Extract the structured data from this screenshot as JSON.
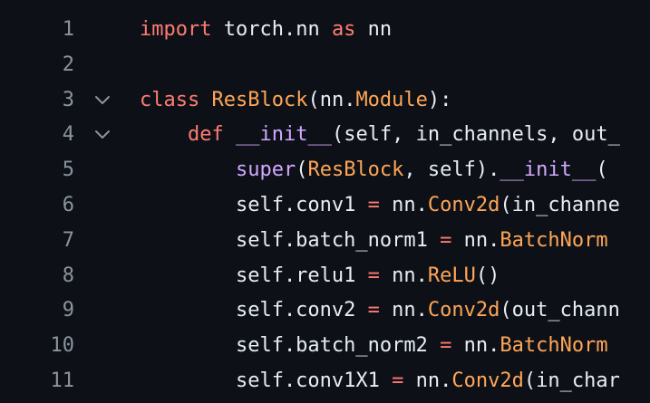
{
  "editor": {
    "lines": [
      {
        "number": "1",
        "foldable": false,
        "tokens": [
          {
            "t": "import",
            "c": "kw"
          },
          {
            "t": " torch.nn ",
            "c": "plain"
          },
          {
            "t": "as",
            "c": "kw"
          },
          {
            "t": " nn",
            "c": "plain"
          }
        ]
      },
      {
        "number": "2",
        "foldable": false,
        "tokens": []
      },
      {
        "number": "3",
        "foldable": true,
        "tokens": [
          {
            "t": "class",
            "c": "kw"
          },
          {
            "t": " ",
            "c": "plain"
          },
          {
            "t": "ResBlock",
            "c": "cls"
          },
          {
            "t": "(nn.",
            "c": "plain"
          },
          {
            "t": "Module",
            "c": "cls"
          },
          {
            "t": "):",
            "c": "plain"
          }
        ]
      },
      {
        "number": "4",
        "foldable": true,
        "tokens": [
          {
            "t": "    ",
            "c": "plain"
          },
          {
            "t": "def",
            "c": "kw"
          },
          {
            "t": " ",
            "c": "plain"
          },
          {
            "t": "__init__",
            "c": "fn"
          },
          {
            "t": "(self, in_channels, out_",
            "c": "plain"
          }
        ]
      },
      {
        "number": "5",
        "foldable": false,
        "tokens": [
          {
            "t": "        ",
            "c": "plain"
          },
          {
            "t": "super",
            "c": "fn"
          },
          {
            "t": "(",
            "c": "plain"
          },
          {
            "t": "ResBlock",
            "c": "cls"
          },
          {
            "t": ", self).",
            "c": "plain"
          },
          {
            "t": "__init__",
            "c": "fn"
          },
          {
            "t": "(",
            "c": "plain"
          }
        ]
      },
      {
        "number": "6",
        "foldable": false,
        "tokens": [
          {
            "t": "        self.conv1 ",
            "c": "plain"
          },
          {
            "t": "=",
            "c": "kw"
          },
          {
            "t": " nn.",
            "c": "plain"
          },
          {
            "t": "Conv2d",
            "c": "cls"
          },
          {
            "t": "(in_channe",
            "c": "plain"
          }
        ]
      },
      {
        "number": "7",
        "foldable": false,
        "tokens": [
          {
            "t": "        self.batch_norm1 ",
            "c": "plain"
          },
          {
            "t": "=",
            "c": "kw"
          },
          {
            "t": " nn.",
            "c": "plain"
          },
          {
            "t": "BatchNorm",
            "c": "cls"
          }
        ]
      },
      {
        "number": "8",
        "foldable": false,
        "tokens": [
          {
            "t": "        self.relu1 ",
            "c": "plain"
          },
          {
            "t": "=",
            "c": "kw"
          },
          {
            "t": " nn.",
            "c": "plain"
          },
          {
            "t": "ReLU",
            "c": "cls"
          },
          {
            "t": "()",
            "c": "plain"
          }
        ]
      },
      {
        "number": "9",
        "foldable": false,
        "tokens": [
          {
            "t": "        self.conv2 ",
            "c": "plain"
          },
          {
            "t": "=",
            "c": "kw"
          },
          {
            "t": " nn.",
            "c": "plain"
          },
          {
            "t": "Conv2d",
            "c": "cls"
          },
          {
            "t": "(out_chann",
            "c": "plain"
          }
        ]
      },
      {
        "number": "10",
        "foldable": false,
        "tokens": [
          {
            "t": "        self.batch_norm2 ",
            "c": "plain"
          },
          {
            "t": "=",
            "c": "kw"
          },
          {
            "t": " nn.",
            "c": "plain"
          },
          {
            "t": "BatchNorm",
            "c": "cls"
          }
        ]
      },
      {
        "number": "11",
        "foldable": false,
        "tokens": [
          {
            "t": "        self.conv1X1 ",
            "c": "plain"
          },
          {
            "t": "=",
            "c": "kw"
          },
          {
            "t": " nn.",
            "c": "plain"
          },
          {
            "t": "Conv2d",
            "c": "cls"
          },
          {
            "t": "(in_char",
            "c": "plain"
          }
        ]
      }
    ],
    "fold_icon": "chevron-down-icon",
    "colors": {
      "background": "#0d1117",
      "line_number": "#8b949e",
      "keyword": "#ff7b72",
      "class_name": "#ffa657",
      "function_name": "#d2a8ff",
      "text": "#e6edf3"
    }
  }
}
